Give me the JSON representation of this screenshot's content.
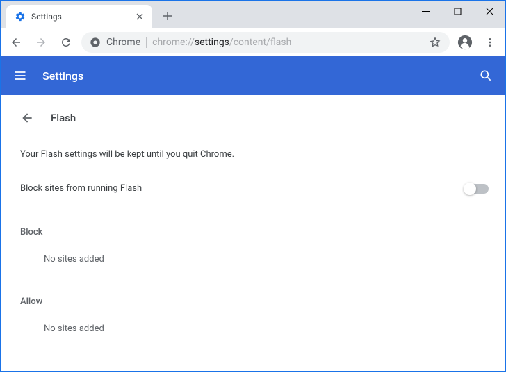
{
  "browser": {
    "tab_title": "Settings",
    "omnibox": {
      "scheme_label": "Chrome",
      "url_grey_prefix": "chrome://",
      "url_dark": "settings",
      "url_grey_suffix": "/content/flash"
    }
  },
  "header": {
    "title": "Settings"
  },
  "page": {
    "title": "Flash",
    "info": "Your Flash settings will be kept until you quit Chrome.",
    "toggle_label": "Block sites from running Flash",
    "toggle_on": false,
    "sections": {
      "block": {
        "title": "Block",
        "empty": "No sites added"
      },
      "allow": {
        "title": "Allow",
        "empty": "No sites added"
      }
    }
  }
}
